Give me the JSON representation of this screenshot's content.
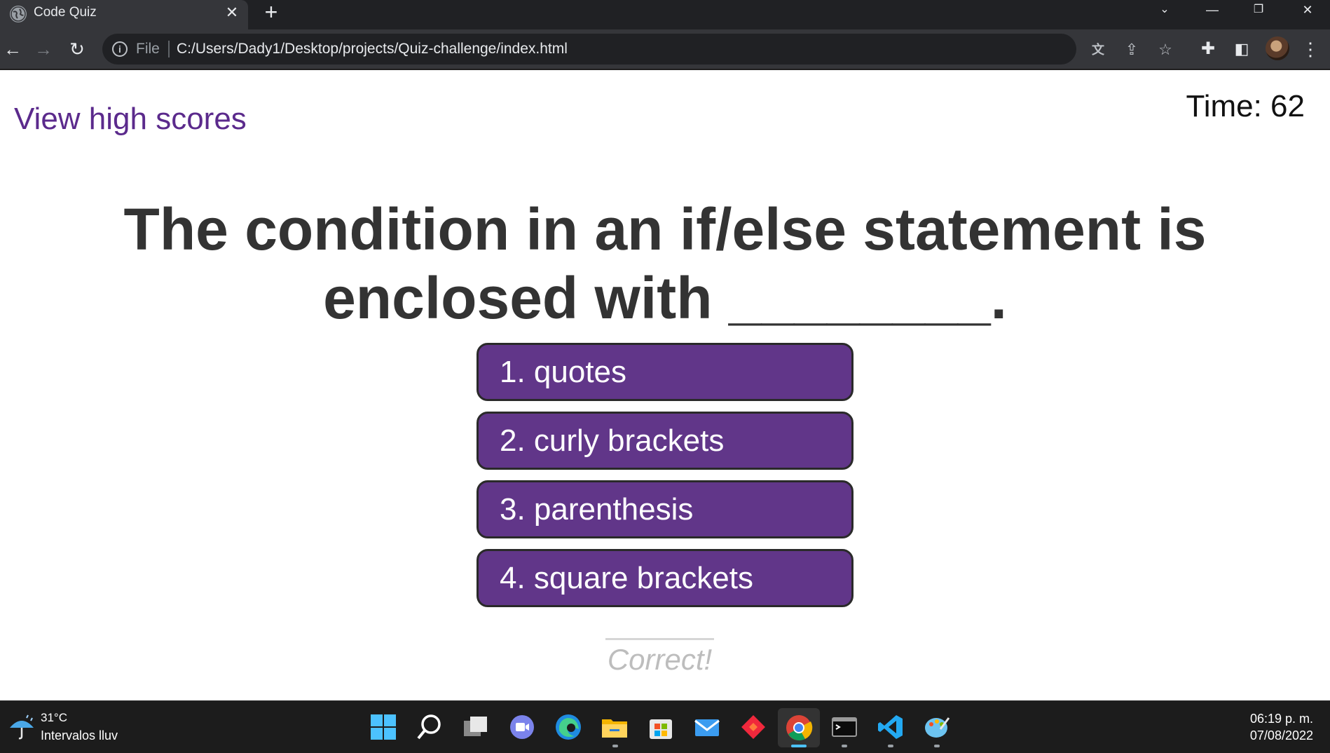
{
  "browser": {
    "tab_title": "Code Quiz",
    "tab_close_glyph": "✕",
    "new_tab_glyph": "+",
    "scheme_label": "File",
    "url": "C:/Users/Dady1/Desktop/projects/Quiz-challenge/index.html",
    "icons": [
      "globe-icon",
      "back-icon",
      "forward-icon",
      "reload-icon",
      "info-icon",
      "translate-icon",
      "share-icon",
      "star-icon",
      "extensions-icon",
      "side-panel-icon",
      "profile-avatar",
      "menu-icon"
    ]
  },
  "page": {
    "high_scores_link": "View high scores",
    "timer_label": "Time: 62",
    "question": "The condition in an if/else statement is enclosed with ________.",
    "choices": [
      "1. quotes",
      "2. curly brackets",
      "3. parenthesis",
      "4. square brackets"
    ],
    "feedback": "Correct!",
    "colors": {
      "link": "#5b2a8c",
      "choice_bg": "#613689",
      "question_text": "#333333",
      "feedback_text": "#bdbdbd"
    }
  },
  "taskbar": {
    "weather_temp": "31°C",
    "weather_desc": "Intervalos lluv",
    "clock_time": "06:19 p. m.",
    "clock_date": "07/08/2022",
    "apps": [
      "windows-start-icon",
      "search-icon",
      "task-view-icon",
      "teams-chat-icon",
      "edge-icon",
      "file-explorer-icon",
      "store-icon",
      "mail-icon",
      "git-icon",
      "chrome-icon",
      "terminal-icon",
      "vscode-icon",
      "paint-icon"
    ]
  }
}
